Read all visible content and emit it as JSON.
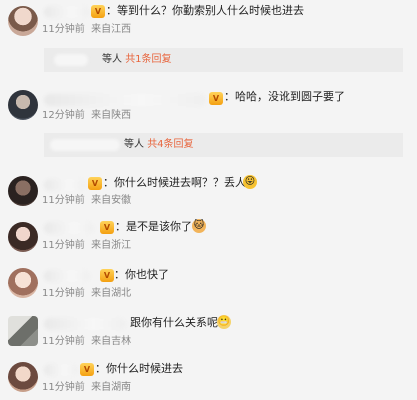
{
  "comments": [
    {
      "text": "：等到什么？你勤索别人什么时候也进去",
      "time": "11分钟前",
      "location": "来自江西",
      "avatar_color": "#c9a898",
      "reply": {
        "who": "等人",
        "count": "共1条回复"
      }
    },
    {
      "text": "：哈哈，没讹到圆子要了",
      "time": "12分钟前",
      "location": "来自陕西",
      "avatar_color": "#4e5561",
      "reply": {
        "who": "等人",
        "count": "共4条回复"
      }
    },
    {
      "text": "：你什么时候进去啊？？丢人",
      "time": "11分钟前",
      "location": "来自安徽",
      "avatar_color": "#4a3a34"
    },
    {
      "text": "：是不是该你了",
      "time": "11分钟前",
      "location": "来自浙江",
      "avatar_color": "#7a5b52"
    },
    {
      "text": "：你也快了",
      "time": "11分钟前",
      "location": "来自湖北",
      "avatar_color": "#d9b6a4"
    },
    {
      "text": "跟你有什么关系呢",
      "time": "11分钟前",
      "location": "来自吉林",
      "avatar_color": "#8d8f8a"
    },
    {
      "text": "：你什么时候进去",
      "time": "11分钟前",
      "location": "来自湖南",
      "avatar_color": "#c79f8a"
    }
  ],
  "icons": {
    "badge": "vip-badge-icon",
    "emoji_1": "tongue-emoji-icon",
    "emoji_2": "cat-emoji-icon",
    "emoji_3": "grin-emoji-icon"
  }
}
